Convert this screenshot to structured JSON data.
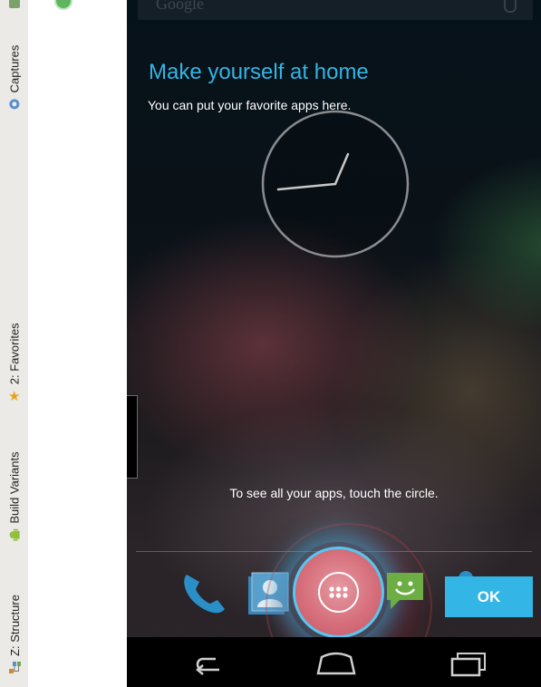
{
  "ide": {
    "tool_tabs": [
      {
        "label": "Captures",
        "icon": "camera-icon"
      },
      {
        "label": "2: Favorites",
        "icon": "star-icon"
      },
      {
        "label": "Build Variants",
        "icon": "android-icon"
      },
      {
        "label": "Z: Structure",
        "icon": "structure-icon"
      }
    ]
  },
  "device": {
    "search_hint": "Google",
    "welcome_title": "Make yourself at home",
    "welcome_subtitle": "You can put your favorite apps here.",
    "hint_text": "To see all your apps, touch the circle.",
    "ok_label": "OK",
    "dock_icons": [
      "phone-icon",
      "contacts-icon",
      "all-apps-icon",
      "messaging-icon",
      "browser-icon"
    ],
    "nav_buttons": [
      "back-icon",
      "home-icon",
      "recent-apps-icon"
    ],
    "colors": {
      "accent": "#33b5e5",
      "all_apps_fill": "#d66f7b",
      "nav_bar": "#000000"
    }
  }
}
